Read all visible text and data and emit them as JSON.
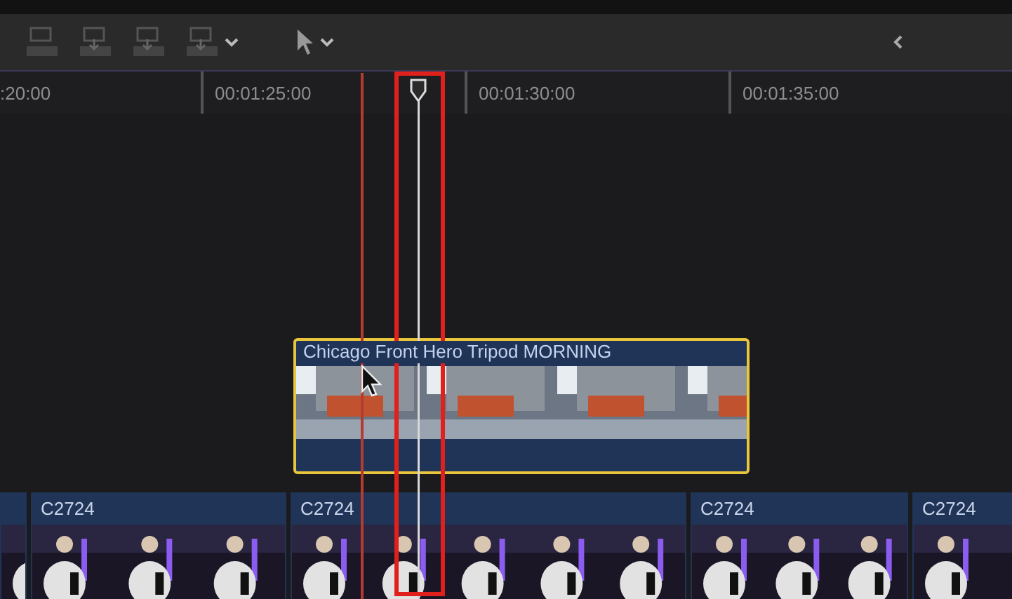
{
  "ruler": {
    "timecodes": [
      ":20:00",
      "00:01:25:00",
      "00:01:30:00",
      "00:01:35:00"
    ]
  },
  "connected_clip": {
    "title": "Chicago Front Hero Tripod MORNING",
    "selected": true
  },
  "storyline": {
    "clips": [
      {
        "name": "C2724",
        "selected": false
      },
      {
        "name": "C2724",
        "selected": false
      },
      {
        "name": "C2724",
        "selected": false
      },
      {
        "name": "C2724",
        "selected": false
      }
    ]
  }
}
